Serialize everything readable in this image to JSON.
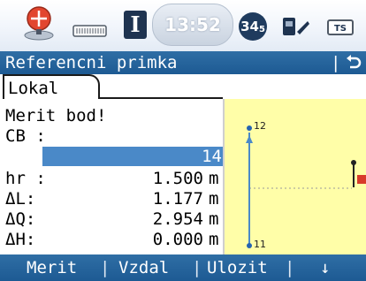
{
  "status": {
    "time": "13:52",
    "channel_badge": "34",
    "channel_sub": "5",
    "ts_label": "TS",
    "ruler_marks": "|||||||||||",
    "cursor_letter": "I"
  },
  "title": {
    "text": "Referencni primka",
    "back_icon": "undo-arrow-icon"
  },
  "tab": {
    "label": "Lokal"
  },
  "fields": {
    "instruction": "Merit bod!",
    "cb_label": "CB :",
    "cb_value": "14",
    "hr_label": "hr :",
    "hr_value": "1.500",
    "dl_label": "ΔL:",
    "dl_value": "1.177",
    "dq_label": "ΔQ:",
    "dq_value": "2.954",
    "dh_label": "ΔH:",
    "dh_value": "0.000",
    "unit": "m"
  },
  "graphic": {
    "point_top": "12",
    "point_bottom": "11",
    "background": "#fffea8",
    "line_color": "#4a89c8"
  },
  "softkeys": {
    "merit": "Merit",
    "vzdal": "Vzdal",
    "ulozit": "Ulozit",
    "sep": "|",
    "down_arrow": "↓"
  },
  "colors": {
    "bar_blue": "#1d5a93",
    "selection_blue": "#4a89c8"
  }
}
